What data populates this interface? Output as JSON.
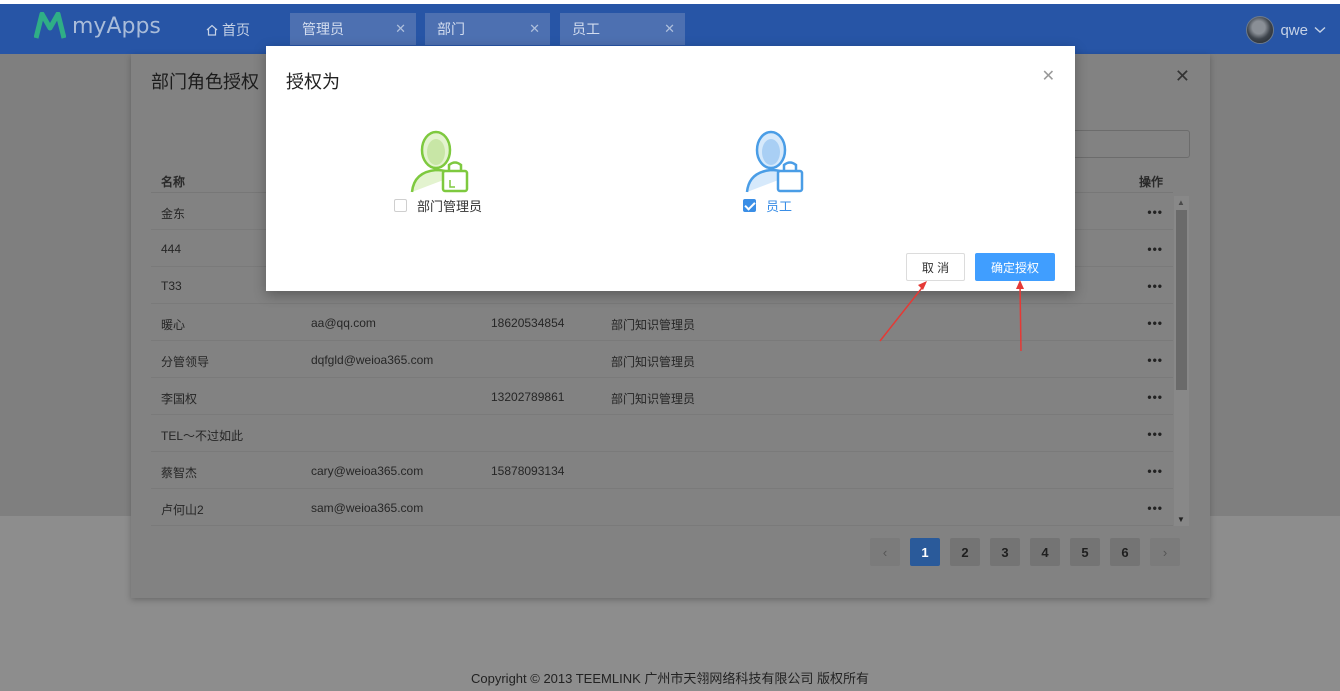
{
  "app": {
    "name": "myApps"
  },
  "nav": {
    "home": "首页",
    "tabs": [
      {
        "label": "管理员"
      },
      {
        "label": "部门"
      },
      {
        "label": "员工"
      }
    ],
    "user": "qwe"
  },
  "panel": {
    "title": "部门角色授权",
    "columns": {
      "name": "名称",
      "actions": "操作"
    },
    "rows": [
      {
        "name": "金东",
        "email": "",
        "phone": "",
        "role": ""
      },
      {
        "name": "444",
        "email": "",
        "phone": "",
        "role": ""
      },
      {
        "name": "T33",
        "email": "",
        "phone": "",
        "role": ""
      },
      {
        "name": "暖心",
        "email": "aa@qq.com",
        "phone": "18620534854",
        "role": "部门知识管理员"
      },
      {
        "name": "分管领导",
        "email": "dqfgld@weioa365.com",
        "phone": "",
        "role": "部门知识管理员"
      },
      {
        "name": "李国权",
        "email": "",
        "phone": "13202789861",
        "role": "部门知识管理员"
      },
      {
        "name": "TEL～不过如此",
        "email": "",
        "phone": "",
        "role": ""
      },
      {
        "name": "蔡智杰",
        "email": "cary@weioa365.com",
        "phone": "15878093134",
        "role": ""
      },
      {
        "name": "卢何山2",
        "email": "sam@weioa365.com",
        "phone": "",
        "role": ""
      }
    ],
    "row_action": "•••",
    "pages": [
      "1",
      "2",
      "3",
      "4",
      "5",
      "6"
    ],
    "current_page": "1",
    "prev": "‹",
    "next": "›"
  },
  "dialog": {
    "title": "授权为",
    "roles": [
      {
        "label": "部门管理员",
        "checked": false,
        "color": "#7ec93f"
      },
      {
        "label": "员工",
        "checked": true,
        "color": "#4a9de6"
      }
    ],
    "cancel": "取 消",
    "confirm": "确定授权"
  },
  "footer": "Copyright © 2013 TEEMLINK 广州市天翎网络科技有限公司 版权所有",
  "colors": {
    "nav": "#2755a6",
    "primary": "#409eff",
    "arrow": "#e53935"
  }
}
